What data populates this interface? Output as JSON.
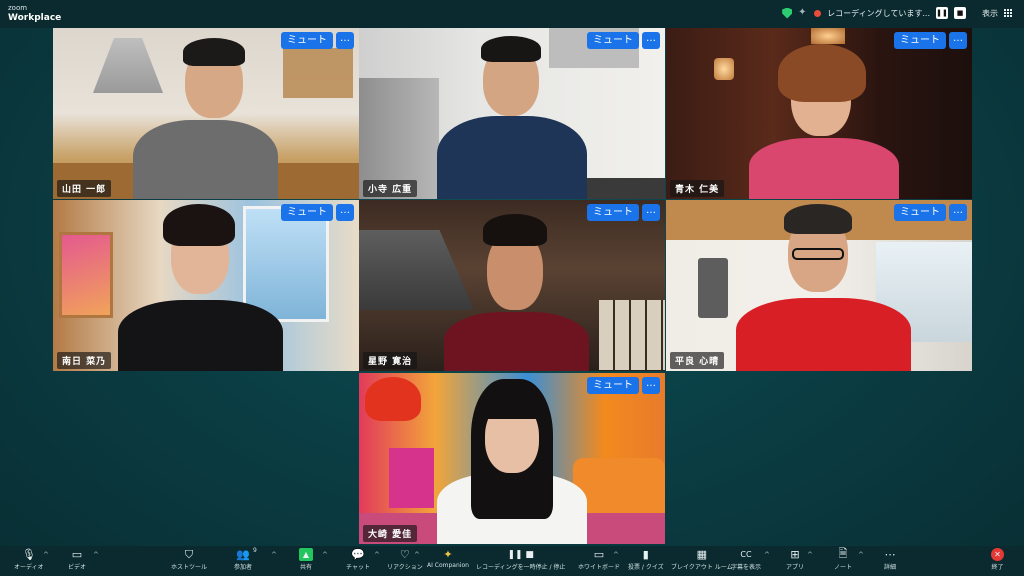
{
  "app": {
    "brand_small": "zoom",
    "brand_large": "Workplace"
  },
  "topbar": {
    "recording_text": "レコーディングしています...",
    "pause_icon": "pause-icon",
    "stop_icon": "stop-icon",
    "view_label": "表示"
  },
  "tiles": [
    {
      "name": "山田 一郎",
      "mute_label": "ミュート",
      "more_label": "…"
    },
    {
      "name": "小寺 広重",
      "mute_label": "ミュート",
      "more_label": "…"
    },
    {
      "name": "青木 仁美",
      "mute_label": "ミュート",
      "more_label": "…"
    },
    {
      "name": "南日 菜乃",
      "mute_label": "ミュート",
      "more_label": "…"
    },
    {
      "name": "星野 寛治",
      "mute_label": "ミュート",
      "more_label": "…"
    },
    {
      "name": "平良 心晴",
      "mute_label": "ミュート",
      "more_label": "…"
    },
    {
      "name": "大崎 愛佳",
      "mute_label": "ミュート",
      "more_label": "…"
    }
  ],
  "toolbar": {
    "audio": "オーディオ",
    "video": "ビデオ",
    "host_tools": "ホストツール",
    "participants": "参加者",
    "participants_count": "9",
    "share": "共有",
    "chat": "チャット",
    "reactions": "リアクション",
    "ai_companion": "AI Companion",
    "recording_control": "レコーディングを一時停止 / 停止",
    "whiteboard": "ホワイトボード",
    "polls": "投票 / クイズ",
    "breakout": "ブレイクアウト ルーム",
    "captions": "字幕を表示",
    "apps": "アプリ",
    "notes": "ノート",
    "more": "詳細",
    "end": "終了"
  },
  "colors": {
    "accent": "#1a73e8",
    "share_green": "#23c55e",
    "end_red": "#e53935",
    "recording": "#e74c3c"
  }
}
